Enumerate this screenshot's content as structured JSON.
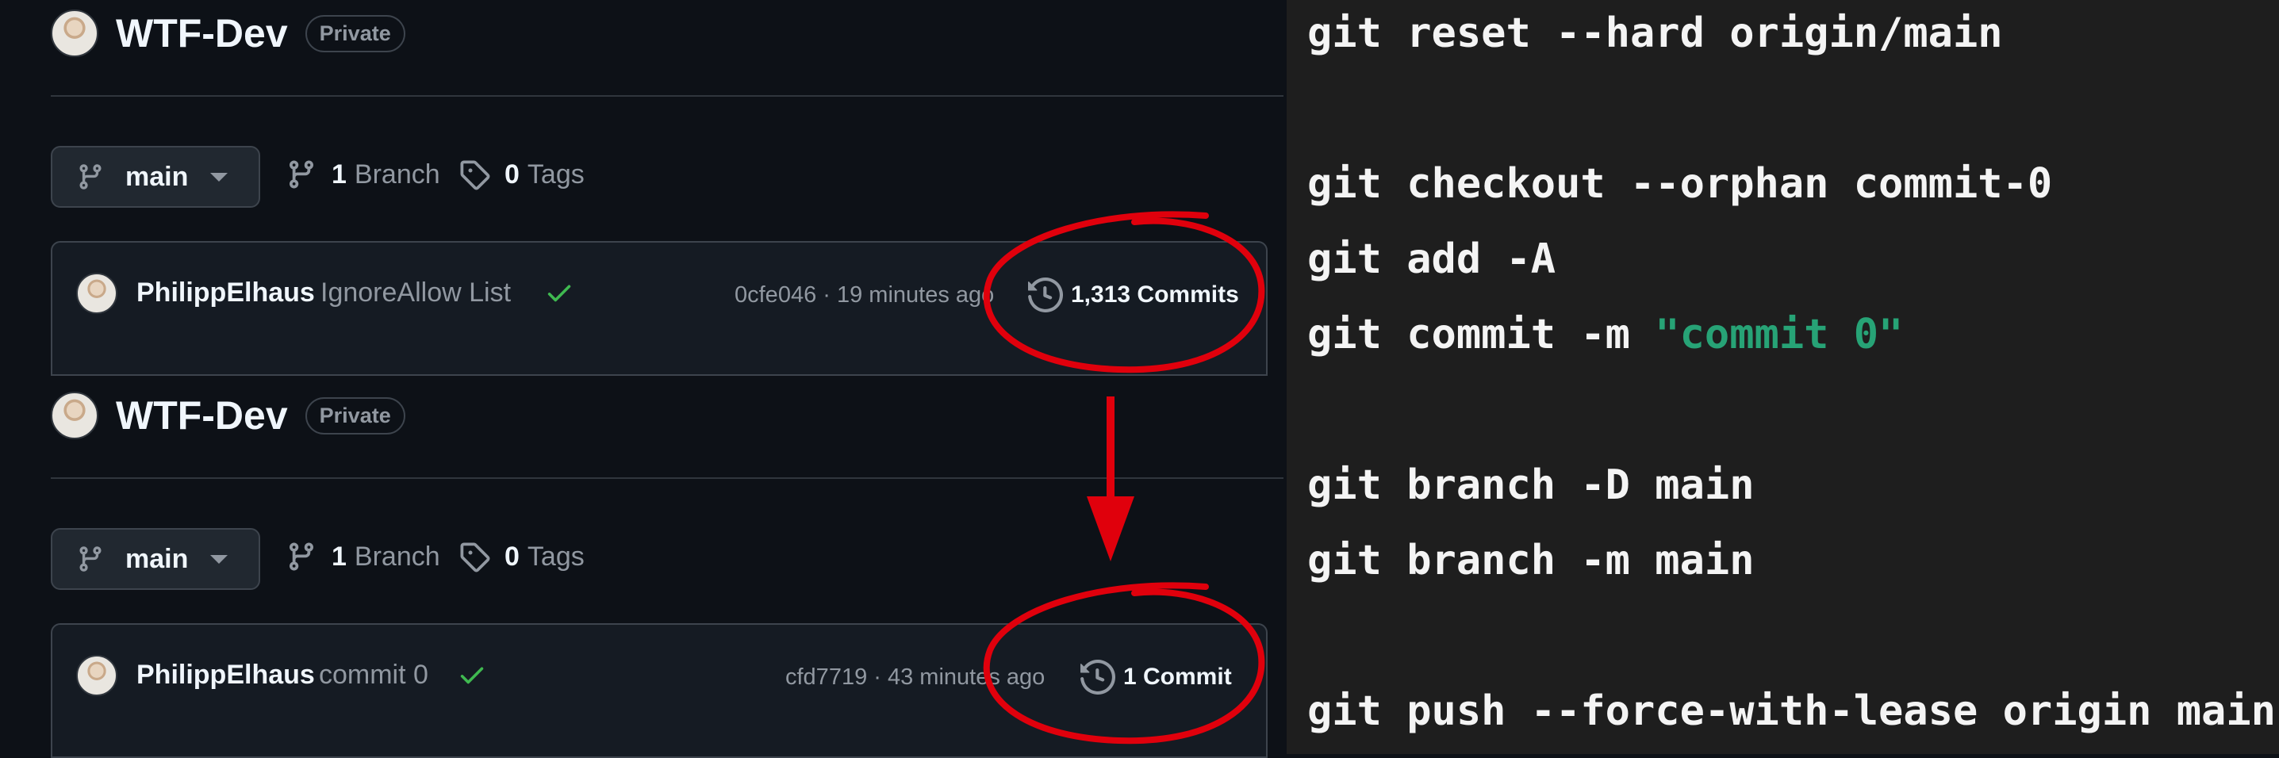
{
  "screens": [
    {
      "repo_name": "WTF-Dev",
      "badge": "Private",
      "branch": "main",
      "branch_count": "1",
      "branch_label": "Branch",
      "tag_count": "0",
      "tag_label": "Tags",
      "commit": {
        "author": "PhilippElhaus",
        "message": "IgnoreAllow List",
        "hash_time": "0cfe046 · 19 minutes ago",
        "count": "1,313 Commits"
      }
    },
    {
      "repo_name": "WTF-Dev",
      "badge": "Private",
      "branch": "main",
      "branch_count": "1",
      "branch_label": "Branch",
      "tag_count": "0",
      "tag_label": "Tags",
      "commit": {
        "author": "PhilippElhaus",
        "message": "commit 0",
        "hash_time": "cfd7719 · 43 minutes ago",
        "count": "1 Commit"
      }
    }
  ],
  "terminal": {
    "lines": [
      "git reset --hard origin/main",
      "git checkout --orphan commit-0",
      "git add -A",
      "git commit -m ",
      "git branch -D main",
      "git branch -m main",
      "git push --force-with-lease origin main"
    ],
    "commit_string": "\"commit 0\""
  },
  "colors": {
    "background": "#0d1117",
    "terminal_bg": "#1e1e1e",
    "annotation_red": "#e0000c",
    "check_green": "#3fb950",
    "string_green": "#27a376"
  }
}
